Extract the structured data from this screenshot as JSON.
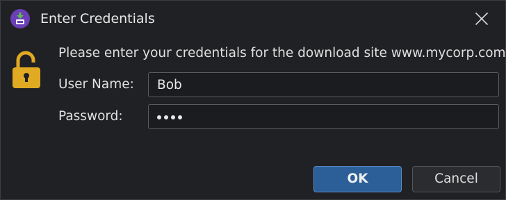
{
  "window": {
    "title": "Enter Credentials",
    "app_icon": "download-app-icon",
    "close_icon": "close-icon"
  },
  "prompt": {
    "message": "Please enter your credentials for the download site www.mycorp.com",
    "icon": "unlocked-padlock-icon",
    "icon_color": "#e0aa22"
  },
  "form": {
    "username_label": "User Name:",
    "username_value": "Bob",
    "password_label": "Password:",
    "password_masked_length": 4
  },
  "buttons": {
    "ok_label": "OK",
    "cancel_label": "Cancel"
  },
  "colors": {
    "background": "#202124",
    "ok_button": "#2c5f97",
    "app_icon": "#6b3fb8",
    "app_icon_arrow": "#5cc04a"
  }
}
